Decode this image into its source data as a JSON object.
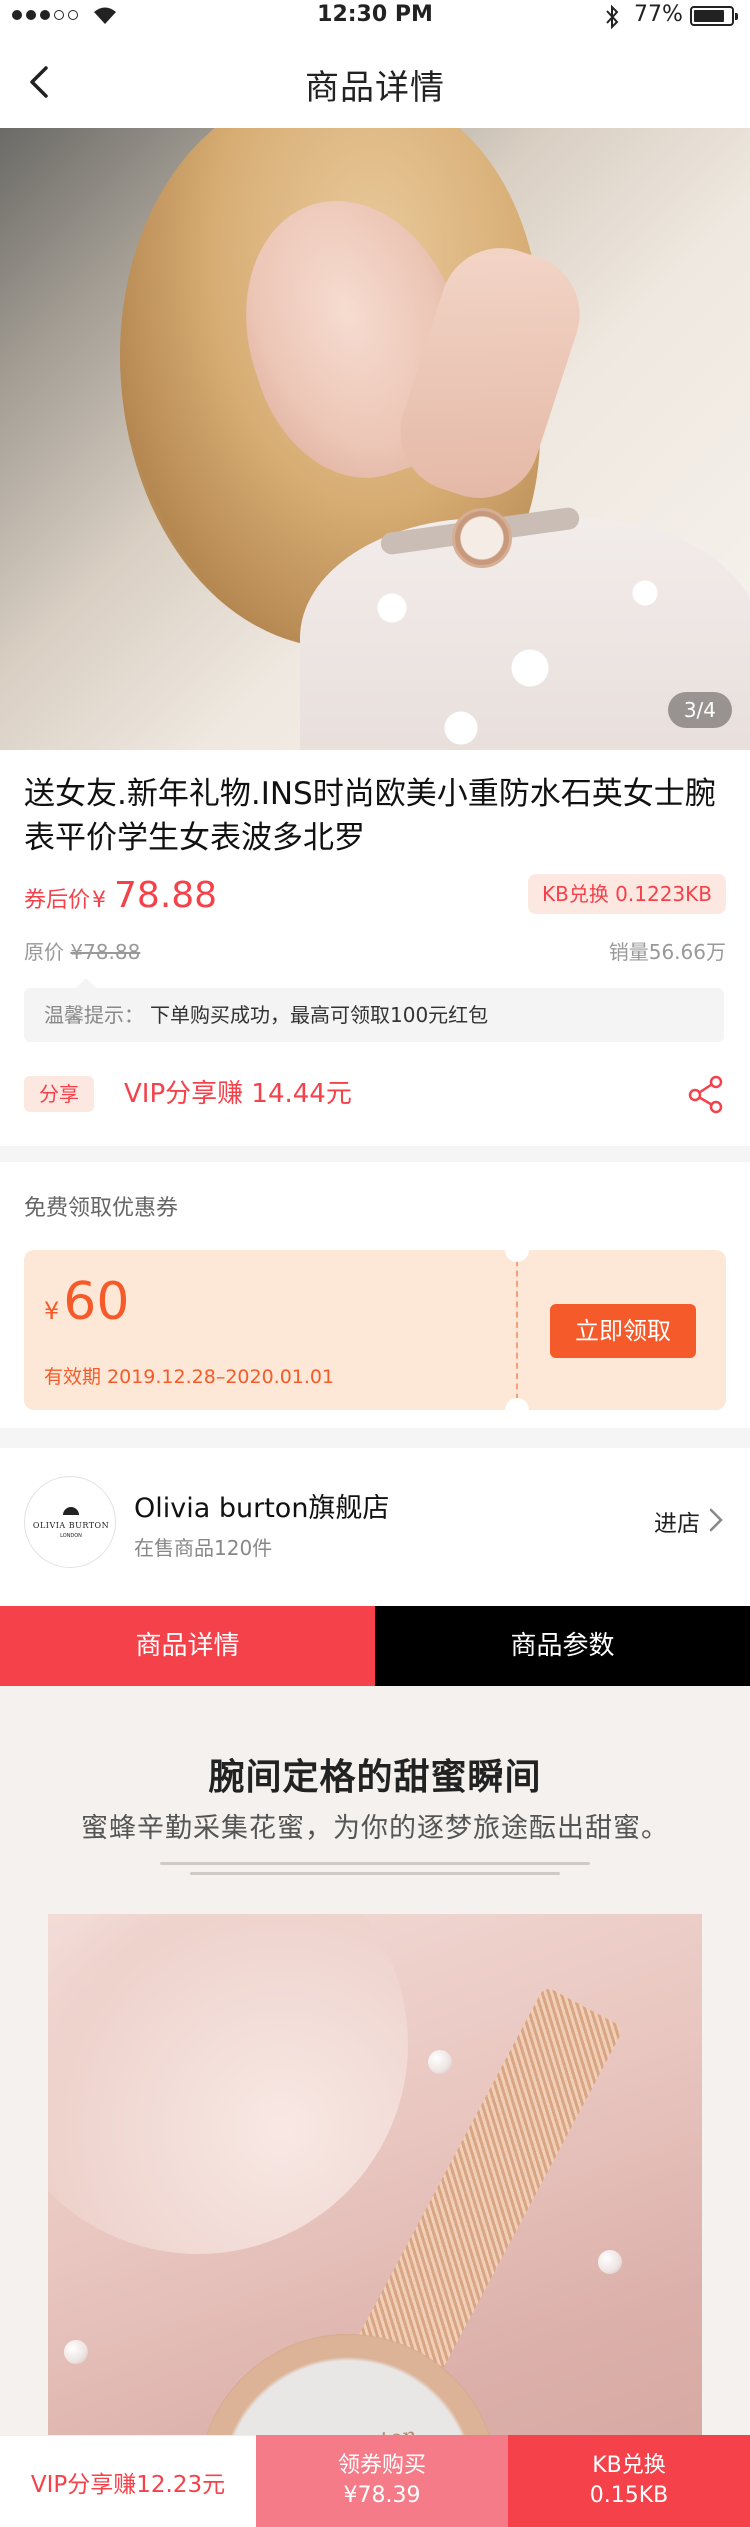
{
  "status_bar": {
    "time": "12:30 PM",
    "battery": "77%"
  },
  "nav": {
    "title": "商品详情"
  },
  "gallery": {
    "counter": "3/4"
  },
  "product": {
    "name": "送女友.新年礼物.INS时尚欧美小重防水石英女士腕表平价学生女表波多北罗",
    "price_label": "券后价",
    "currency": "¥",
    "price": "78.88",
    "kb_badge": "KB兑换 0.1223KB",
    "original_label": "原价",
    "original_price": "¥78.88",
    "sales": "销量56.66万",
    "tip_label": "温馨提示：",
    "tip_text": "下单购买成功，最高可领取100元红包",
    "share_tag": "分享",
    "vip_share": "VIP分享赚 14.44元"
  },
  "coupon": {
    "section_title": "免费领取优惠券",
    "currency": "¥",
    "amount": "60",
    "validity": "有效期 2019.12.28–2020.01.01",
    "button": "立即领取"
  },
  "shop": {
    "logo_text": "OLIVIA BURTON",
    "logo_sub": "LONDON",
    "name": "Olivia burton旗舰店",
    "count": "在售商品120件",
    "enter": "进店"
  },
  "tabs": [
    {
      "label": "商品详情",
      "active": true
    },
    {
      "label": "商品参数",
      "active": false
    }
  ],
  "detail": {
    "heading": "腕间定格的甜蜜瞬间",
    "subheading": "蜜蜂辛勤采集花蜜，为你的逐梦旅途酝出甜蜜。",
    "watch_brand": "Olivia Burton"
  },
  "bottom_bar": {
    "vip_share": "VIP分享赚12.23元",
    "buy_label": "领券购买",
    "buy_price": "¥78.39",
    "kb_label": "KB兑换",
    "kb_value": "0.15KB"
  },
  "colors": {
    "accent": "#f5414a",
    "coupon_orange": "#f55b2a",
    "coupon_bg": "#fde8d7"
  }
}
